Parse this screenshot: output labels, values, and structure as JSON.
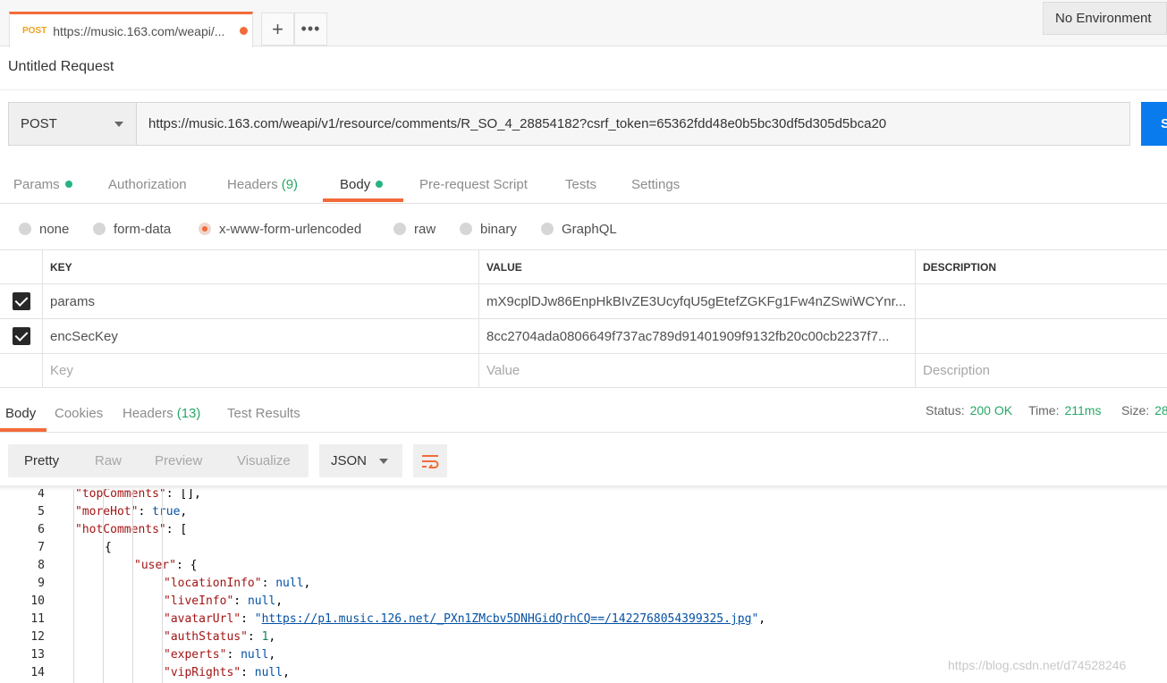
{
  "tab": {
    "method": "POST",
    "title": "https://music.163.com/weapi/..."
  },
  "environment": {
    "label": "No Environment"
  },
  "request": {
    "title": "Untitled Request",
    "method": "POST",
    "url": "https://music.163.com/weapi/v1/resource/comments/R_SO_4_28854182?csrf_token=65362fdd48e0b5bc30df5d305d5bca20",
    "send_label": "S"
  },
  "request_tabs": [
    {
      "label": "Params",
      "count": "",
      "dot": true
    },
    {
      "label": "Authorization",
      "count": "",
      "dot": false
    },
    {
      "label": "Headers",
      "count": "(9)",
      "dot": false
    },
    {
      "label": "Body",
      "count": "",
      "dot": true
    },
    {
      "label": "Pre-request Script",
      "count": "",
      "dot": false
    },
    {
      "label": "Tests",
      "count": "",
      "dot": false
    },
    {
      "label": "Settings",
      "count": "",
      "dot": false
    }
  ],
  "body_types": [
    "none",
    "form-data",
    "x-www-form-urlencoded",
    "raw",
    "binary",
    "GraphQL"
  ],
  "body_type_selected": "x-www-form-urlencoded",
  "kv_table": {
    "headers": [
      "KEY",
      "VALUE",
      "DESCRIPTION"
    ],
    "rows": [
      {
        "key": "params",
        "value": "mX9cplDJw86EnpHkBIvZE3UcyfqU5gEtefZGKFg1Fw4nZSwiWCYnr...",
        "description": "",
        "checked": true
      },
      {
        "key": "encSecKey",
        "value": "8cc2704ada0806649f737ac789d91401909f9132fb20c00cb2237f7...",
        "description": "",
        "checked": true
      }
    ],
    "placeholder": {
      "key": "Key",
      "value": "Value",
      "description": "Description"
    }
  },
  "response_tabs": [
    {
      "label": "Body",
      "count": ""
    },
    {
      "label": "Cookies",
      "count": ""
    },
    {
      "label": "Headers",
      "count": "(13)"
    },
    {
      "label": "Test Results",
      "count": ""
    }
  ],
  "response_status": {
    "status_label": "Status:",
    "status_value": "200 OK",
    "time_label": "Time:",
    "time_value": "211ms",
    "size_label": "Size:",
    "size_value": "28"
  },
  "view_modes": [
    "Pretty",
    "Raw",
    "Preview",
    "Visualize"
  ],
  "format": "JSON",
  "icons": {
    "wrap": "wrap-lines-icon",
    "caret": "chevron-down-icon",
    "more": "more-horizontal-icon",
    "add": "plus-icon"
  },
  "colors": {
    "accent": "#f26b3a",
    "send": "#097bed",
    "success": "#26a867",
    "method": "#f0a01c"
  },
  "code_lines": [
    {
      "n": "4",
      "indent": 1,
      "tokens": [
        [
          "k",
          "\"topComments\""
        ],
        [
          "p",
          ": [],"
        ]
      ]
    },
    {
      "n": "5",
      "indent": 1,
      "tokens": [
        [
          "k",
          "\"moreHot\""
        ],
        [
          "p",
          ": "
        ],
        [
          "b",
          "true"
        ],
        [
          "p",
          ","
        ]
      ]
    },
    {
      "n": "6",
      "indent": 1,
      "tokens": [
        [
          "k",
          "\"hotComments\""
        ],
        [
          "p",
          ": ["
        ]
      ]
    },
    {
      "n": "7",
      "indent": 2,
      "tokens": [
        [
          "p",
          "{"
        ]
      ]
    },
    {
      "n": "8",
      "indent": 3,
      "tokens": [
        [
          "k",
          "\"user\""
        ],
        [
          "p",
          ": {"
        ]
      ]
    },
    {
      "n": "9",
      "indent": 4,
      "tokens": [
        [
          "k",
          "\"locationInfo\""
        ],
        [
          "p",
          ": "
        ],
        [
          "b",
          "null"
        ],
        [
          "p",
          ","
        ]
      ]
    },
    {
      "n": "10",
      "indent": 4,
      "tokens": [
        [
          "k",
          "\"liveInfo\""
        ],
        [
          "p",
          ": "
        ],
        [
          "b",
          "null"
        ],
        [
          "p",
          ","
        ]
      ]
    },
    {
      "n": "11",
      "indent": 4,
      "tokens": [
        [
          "k",
          "\"avatarUrl\""
        ],
        [
          "p",
          ": "
        ],
        [
          "s",
          "\""
        ],
        [
          "u",
          "https://p1.music.126.net/_PXn1ZMcbv5DNHGidQrhCQ==/1422768054399325.jpg"
        ],
        [
          "s",
          "\""
        ],
        [
          "p",
          ","
        ]
      ]
    },
    {
      "n": "12",
      "indent": 4,
      "tokens": [
        [
          "k",
          "\"authStatus\""
        ],
        [
          "p",
          ": "
        ],
        [
          "n",
          "1"
        ],
        [
          "p",
          ","
        ]
      ]
    },
    {
      "n": "13",
      "indent": 4,
      "tokens": [
        [
          "k",
          "\"experts\""
        ],
        [
          "p",
          ": "
        ],
        [
          "b",
          "null"
        ],
        [
          "p",
          ","
        ]
      ]
    },
    {
      "n": "14",
      "indent": 4,
      "tokens": [
        [
          "k",
          "\"vipRights\""
        ],
        [
          "p",
          ": "
        ],
        [
          "b",
          "null"
        ],
        [
          "p",
          ","
        ]
      ]
    }
  ],
  "watermark": "https://blog.csdn.net/d74528246"
}
